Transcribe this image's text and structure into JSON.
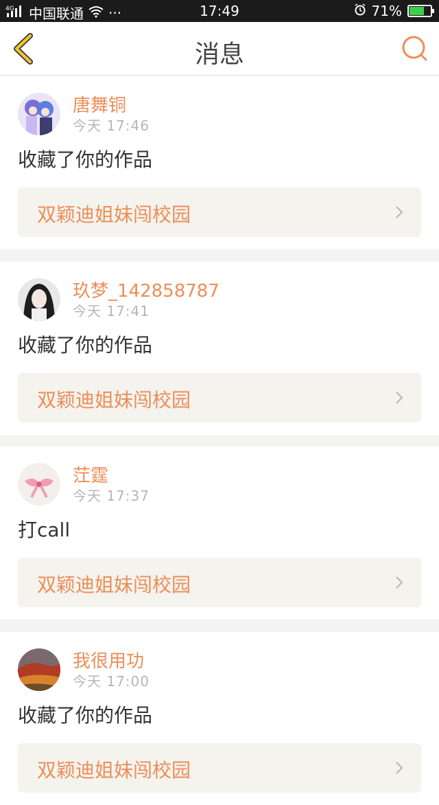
{
  "status": {
    "carrier": "中国联通",
    "signal_label": "4G",
    "dots": "···",
    "time": "17:49",
    "battery": "71%",
    "battery_level": 0.71
  },
  "header": {
    "title": "消息"
  },
  "icons": {
    "back": "chevron-left-icon",
    "search": "search-icon",
    "chevron": "chevron-right-icon"
  },
  "colors": {
    "accent": "#ec8e58",
    "back_icon": "#f1c232"
  },
  "messages": [
    {
      "user": "唐舞铜",
      "time": "今天 17:46",
      "action": "收藏了你的作品",
      "work": "双颖迪姐妹闯校园"
    },
    {
      "user": "玖梦_142858787",
      "time": "今天 17:41",
      "action": "收藏了你的作品",
      "work": "双颖迪姐妹闯校园"
    },
    {
      "user": "茳霆",
      "time": "今天 17:37",
      "action": "打call",
      "work": "双颖迪姐妹闯校园"
    },
    {
      "user": "我很用功",
      "time": "今天 17:00",
      "action": "收藏了你的作品",
      "work": "双颖迪姐妹闯校园"
    }
  ]
}
